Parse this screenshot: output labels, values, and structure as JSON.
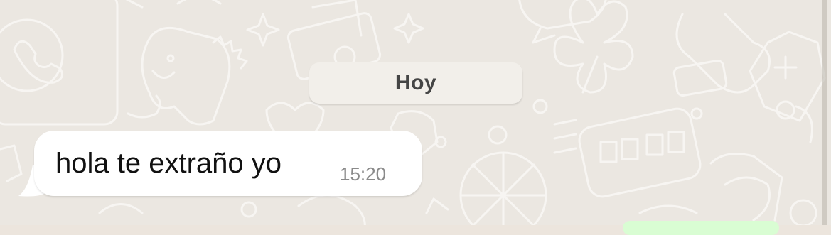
{
  "chat": {
    "date_separator": "Hoy",
    "messages": [
      {
        "direction": "incoming",
        "text": "hola te extraño yo",
        "time": "15:20"
      }
    ]
  },
  "colors": {
    "background": "#ebe7e1",
    "incoming_bubble": "#ffffff",
    "date_chip": "#f2efea",
    "outgoing_bubble": "#d9fdd3",
    "time_text": "#8a8a8a"
  }
}
